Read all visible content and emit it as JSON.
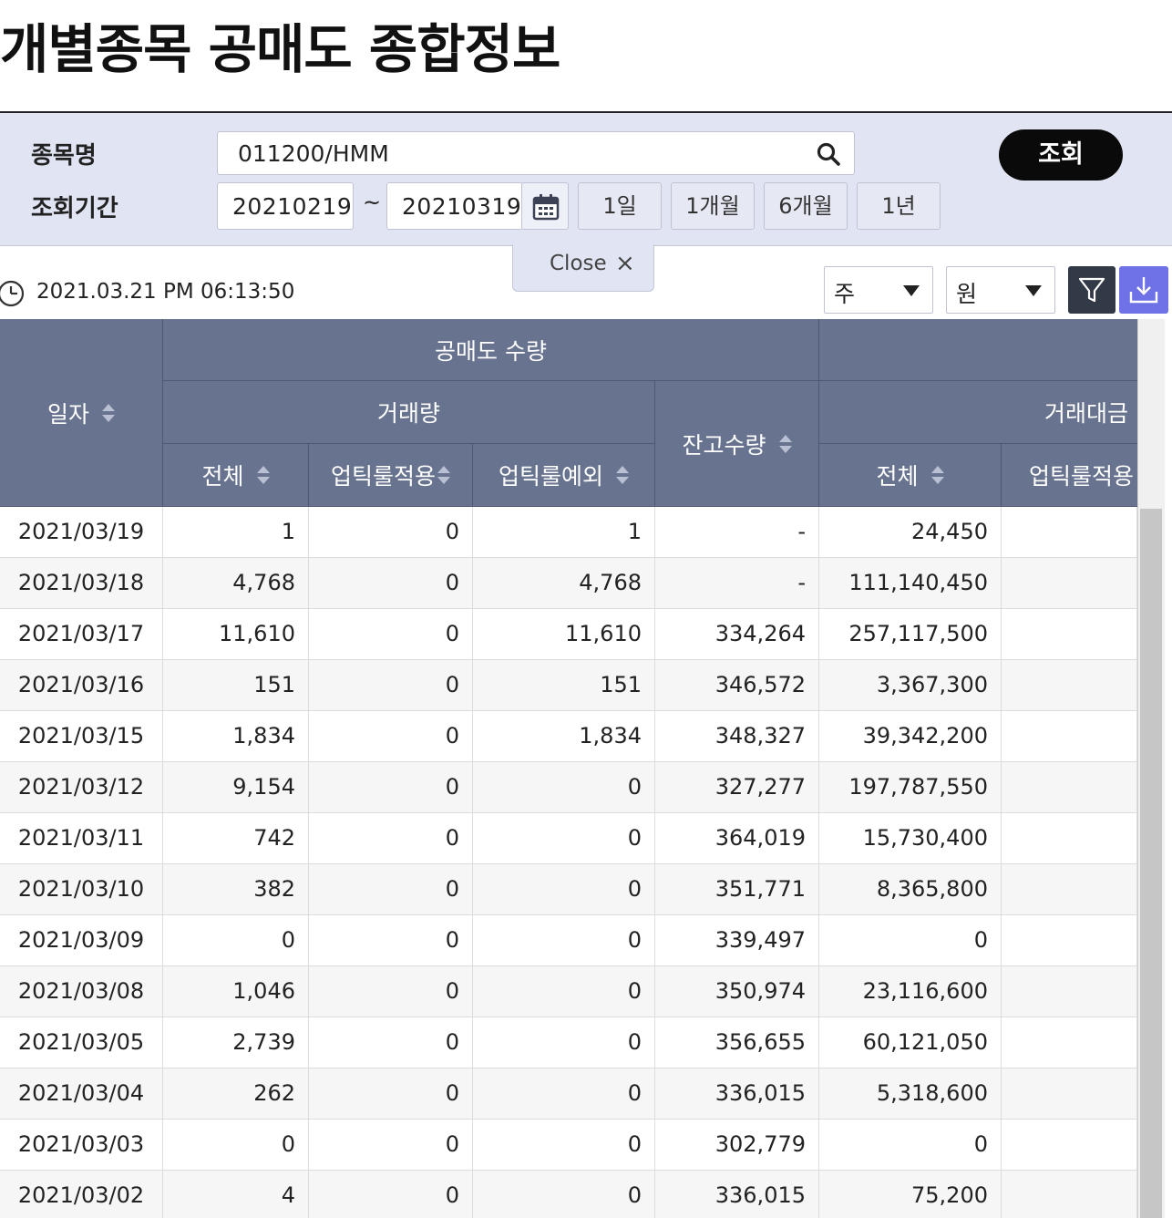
{
  "page": {
    "title": "개별종목 공매도 종합정보"
  },
  "search": {
    "stock_label": "종목명",
    "stock_value": "011200/HMM",
    "period_label": "조회기간",
    "date_from": "20210219",
    "tilde": "~",
    "date_to": "20210319",
    "period_buttons": [
      "1일",
      "1개월",
      "6개월",
      "1년"
    ],
    "query_button": "조회"
  },
  "close_tab": {
    "label": "Close",
    "icon": "×"
  },
  "toolbar": {
    "timestamp": "2021.03.21 PM 06:13:50",
    "unit_select": "주",
    "currency_select": "원"
  },
  "table": {
    "headers": {
      "date": "일자",
      "short_qty": "공매도 수량",
      "volume": "거래량",
      "total": "전체",
      "uptick_applied": "업틱룰적용",
      "uptick_exception": "업틱룰예외",
      "balance": "잔고수량",
      "amount": "거래대금",
      "amount_total": "전체",
      "amount_uptick": "업틱룰적용"
    },
    "rows": [
      {
        "date": "2021/03/19",
        "total": "1",
        "uptick": "0",
        "except": "1",
        "balance": "-",
        "amount": "24,450",
        "amount_uptick": ""
      },
      {
        "date": "2021/03/18",
        "total": "4,768",
        "uptick": "0",
        "except": "4,768",
        "balance": "-",
        "amount": "111,140,450",
        "amount_uptick": ""
      },
      {
        "date": "2021/03/17",
        "total": "11,610",
        "uptick": "0",
        "except": "11,610",
        "balance": "334,264",
        "amount": "257,117,500",
        "amount_uptick": ""
      },
      {
        "date": "2021/03/16",
        "total": "151",
        "uptick": "0",
        "except": "151",
        "balance": "346,572",
        "amount": "3,367,300",
        "amount_uptick": ""
      },
      {
        "date": "2021/03/15",
        "total": "1,834",
        "uptick": "0",
        "except": "1,834",
        "balance": "348,327",
        "amount": "39,342,200",
        "amount_uptick": ""
      },
      {
        "date": "2021/03/12",
        "total": "9,154",
        "uptick": "0",
        "except": "0",
        "balance": "327,277",
        "amount": "197,787,550",
        "amount_uptick": ""
      },
      {
        "date": "2021/03/11",
        "total": "742",
        "uptick": "0",
        "except": "0",
        "balance": "364,019",
        "amount": "15,730,400",
        "amount_uptick": ""
      },
      {
        "date": "2021/03/10",
        "total": "382",
        "uptick": "0",
        "except": "0",
        "balance": "351,771",
        "amount": "8,365,800",
        "amount_uptick": ""
      },
      {
        "date": "2021/03/09",
        "total": "0",
        "uptick": "0",
        "except": "0",
        "balance": "339,497",
        "amount": "0",
        "amount_uptick": ""
      },
      {
        "date": "2021/03/08",
        "total": "1,046",
        "uptick": "0",
        "except": "0",
        "balance": "350,974",
        "amount": "23,116,600",
        "amount_uptick": ""
      },
      {
        "date": "2021/03/05",
        "total": "2,739",
        "uptick": "0",
        "except": "0",
        "balance": "356,655",
        "amount": "60,121,050",
        "amount_uptick": ""
      },
      {
        "date": "2021/03/04",
        "total": "262",
        "uptick": "0",
        "except": "0",
        "balance": "336,015",
        "amount": "5,318,600",
        "amount_uptick": ""
      },
      {
        "date": "2021/03/03",
        "total": "0",
        "uptick": "0",
        "except": "0",
        "balance": "302,779",
        "amount": "0",
        "amount_uptick": ""
      },
      {
        "date": "2021/03/02",
        "total": "4",
        "uptick": "0",
        "except": "0",
        "balance": "336,015",
        "amount": "75,200",
        "amount_uptick": ""
      }
    ]
  },
  "icons": {
    "search": "search-icon",
    "calendar": "calendar-icon",
    "clock": "clock-icon",
    "filter": "filter-icon",
    "download": "download-icon"
  },
  "colors": {
    "panel_bg": "#e1e4f2",
    "header_bg": "#68738f",
    "query_btn": "#0a0a0a",
    "download_btn": "#6f71e6",
    "filter_btn": "#333a47"
  }
}
